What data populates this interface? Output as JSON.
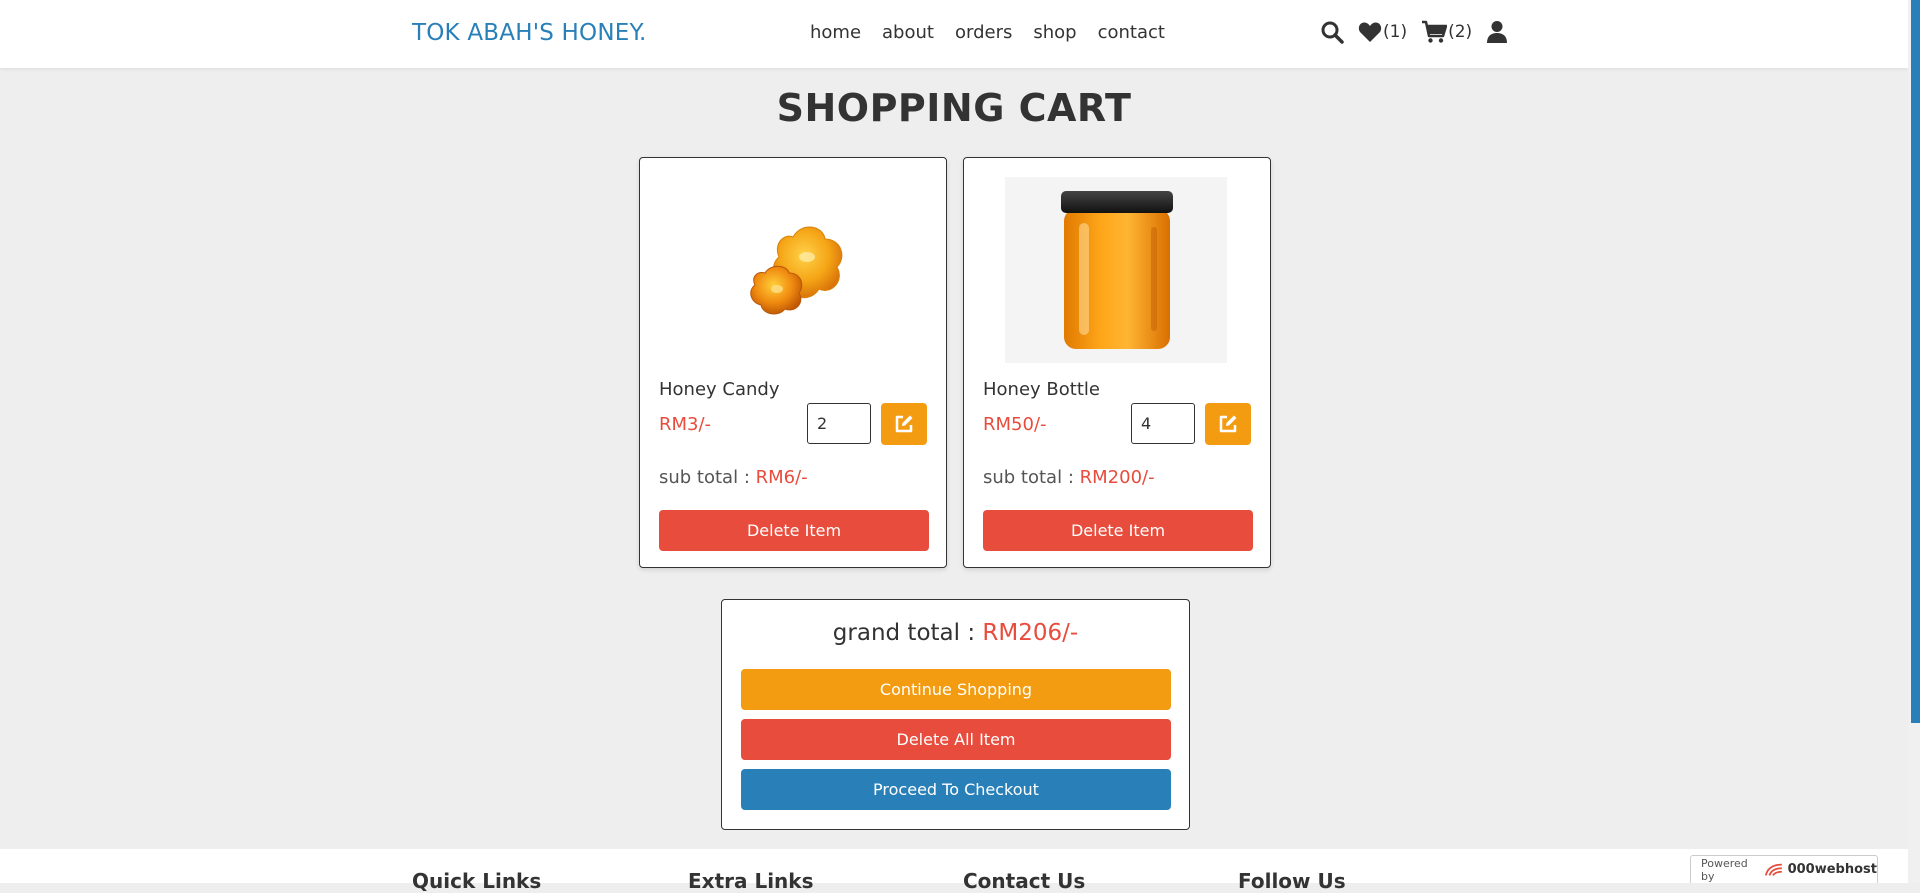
{
  "header": {
    "logo": "TOK ABAH'S HONEY.",
    "nav": [
      "home",
      "about",
      "orders",
      "shop",
      "contact"
    ],
    "wishlist_count": "(1)",
    "cart_count": "(2)"
  },
  "page_title": "SHOPPING CART",
  "cart_items": [
    {
      "name": "Honey Candy",
      "price": "RM3/-",
      "quantity": "2",
      "subtotal_label": "sub total :",
      "subtotal_value": "RM6/-",
      "delete_label": "Delete Item",
      "image": "honey-candy-image"
    },
    {
      "name": "Honey Bottle",
      "price": "RM50/-",
      "quantity": "4",
      "subtotal_label": "sub total :",
      "subtotal_value": "RM200/-",
      "delete_label": "Delete Item",
      "image": "honey-jar-image"
    }
  ],
  "summary": {
    "grand_total_label": "grand total :",
    "grand_total_value": "RM206/-",
    "continue_label": "Continue Shopping",
    "delete_all_label": "Delete All Item",
    "checkout_label": "Proceed To Checkout"
  },
  "footer": {
    "headings": [
      "Quick Links",
      "Extra Links",
      "Contact Us",
      "Follow Us"
    ]
  },
  "badge": {
    "prefix": "Powered by",
    "brand": "000webhost"
  },
  "colors": {
    "accent_blue": "#2980b9",
    "accent_orange": "#f39c12",
    "danger_red": "#e74c3c",
    "background": "#eeeeee"
  },
  "icons": [
    "search-icon",
    "heart-icon",
    "cart-icon",
    "user-icon",
    "edit-icon"
  ]
}
